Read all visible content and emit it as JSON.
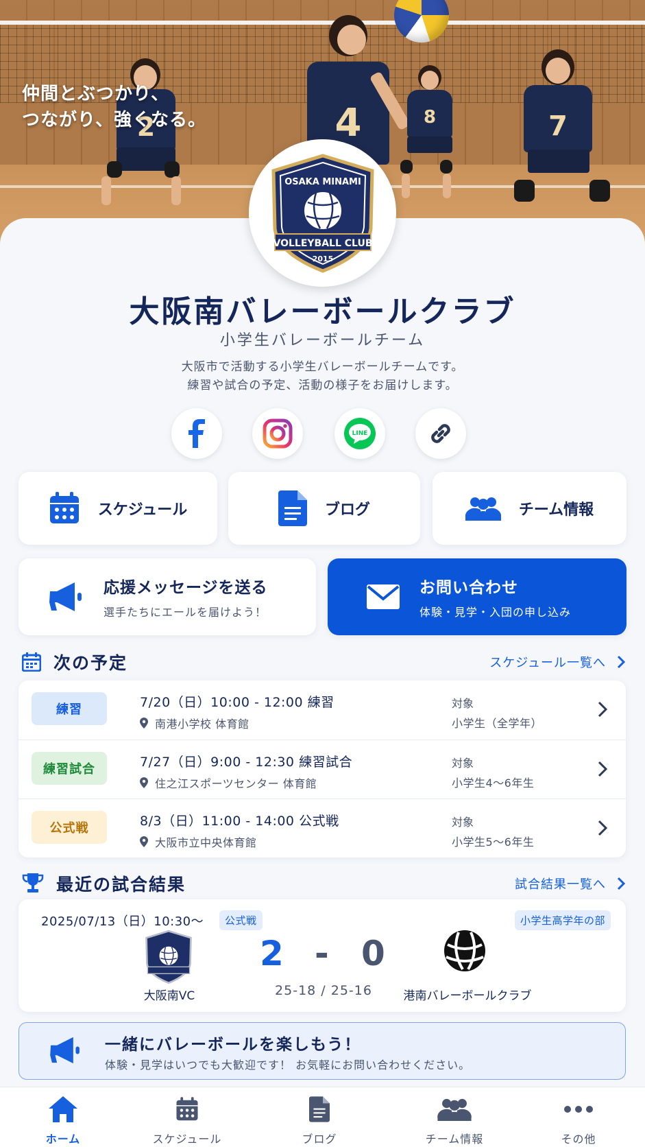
{
  "hero": {
    "tagline": "仲間とぶつかり、\nつながり、強くなる。"
  },
  "logo": {
    "top_text": "OSAKA MINAMI",
    "bottom_text": "VOLLEYBALL CLUB",
    "year": "2015"
  },
  "team": {
    "name": "大阪南バレーボールクラブ",
    "subtitle": "小学生バレーボールチーム",
    "description_1": "大阪市で活動する小学生バレーボールチームです。",
    "description_2": "練習や試合の予定、活動の様子をお届けします。"
  },
  "social": [
    {
      "icon": "facebook-icon"
    },
    {
      "icon": "instagram-icon"
    },
    {
      "icon": "line-icon",
      "text": "LINE"
    },
    {
      "icon": "link-icon"
    }
  ],
  "nav_buttons": [
    {
      "label": "スケジュール",
      "icon": "calendar-icon"
    },
    {
      "label": "ブログ",
      "icon": "document-icon"
    },
    {
      "label": "チーム情報",
      "icon": "users-icon"
    }
  ],
  "actions": {
    "cheer": {
      "title": "応援メッセージを送る",
      "subtitle": "選手たちにエールを届けよう！"
    },
    "contact": {
      "title": "お問い合わせ",
      "subtitle": "体験・見学・入団の申し込み"
    }
  },
  "upcoming": {
    "title": "次の予定",
    "link": "スケジュール一覧へ",
    "items": [
      {
        "badge": "練習",
        "title": "7/20（日）10:00 - 12:00  練習",
        "place": "南港小学校 体育館",
        "target_label": "対象",
        "target": "小学生（全学年）"
      },
      {
        "badge": "練習試合",
        "title": "7/27（日）9:00 - 12:30  練習試合",
        "place": "住之江スポーツセンター 体育館",
        "target_label": "対象",
        "target": "小学生4〜6年生"
      },
      {
        "badge": "公式戦",
        "title": "8/3（日）11:00 - 14:00  公式戦",
        "place": "大阪市立中央体育館",
        "target_label": "対象",
        "target": "小学生5〜6年生"
      }
    ]
  },
  "results": {
    "title": "最近の試合結果",
    "link": "試合結果一覧へ",
    "match": {
      "datetime": "2025/07/13（日）10:30〜",
      "type": "公式戦",
      "division": "小学生高学年の部",
      "home_team": "大阪南VC",
      "home_score": "2",
      "dash": "-",
      "away_score": "0",
      "away_team": "港南バレーボールクラブ",
      "sets": "25-18 / 25-16"
    }
  },
  "promo": {
    "title": "一緒にバレーボールを楽しもう！",
    "text": "体験・見学はいつでも大歓迎です！ お気軽にお問い合わせください。"
  },
  "tabs": [
    {
      "label": "ホーム",
      "icon": "home-icon",
      "active": true
    },
    {
      "label": "スケジュール",
      "icon": "calendar-icon"
    },
    {
      "label": "ブログ",
      "icon": "document-icon"
    },
    {
      "label": "チーム情報",
      "icon": "users-icon"
    },
    {
      "label": "その他",
      "icon": "more-icon"
    }
  ],
  "colors": {
    "primary": "#1660e0",
    "navy": "#15275a",
    "practice": "#dce9fb",
    "practice_game": "#dff2e0",
    "official": "#fdf0d5"
  }
}
